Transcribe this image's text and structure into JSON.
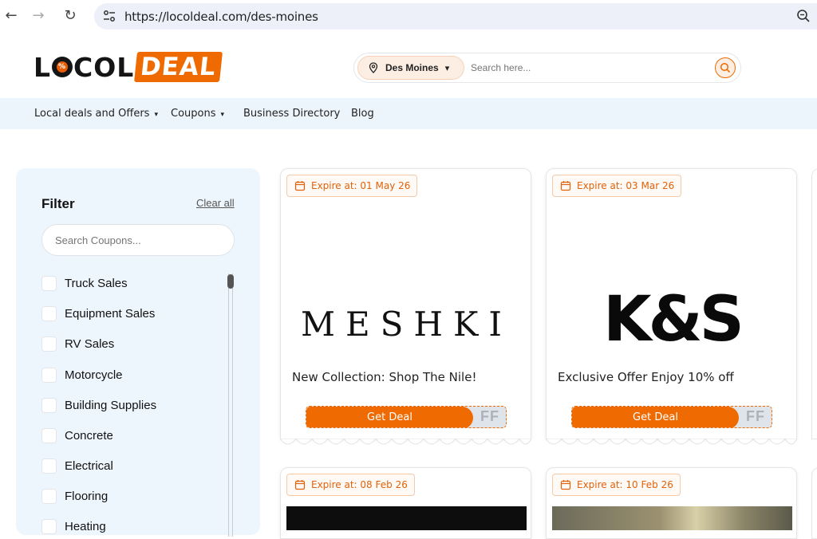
{
  "browser": {
    "url": "https://locoldeal.com/des-moines",
    "back_icon": "←",
    "forward_icon": "→",
    "reload_icon": "↻"
  },
  "header": {
    "logo_loco_l": "L",
    "logo_loco_rest": "COL",
    "logo_deal": "DEAL",
    "city": "Des Moines",
    "search_placeholder": "Search here..."
  },
  "nav": {
    "items": [
      {
        "label": "Local deals and Offers",
        "chevron": "▾"
      },
      {
        "label": "Coupons",
        "chevron": "▾"
      },
      {
        "label": "Business Directory"
      },
      {
        "label": "Blog"
      }
    ]
  },
  "filter": {
    "title": "Filter",
    "clear_all": "Clear all",
    "search_placeholder": "Search Coupons...",
    "categories": [
      "Truck Sales",
      "Equipment Sales",
      "RV Sales",
      "Motorcycle",
      "Building Supplies",
      "Concrete",
      "Electrical",
      "Flooring",
      "Heating"
    ]
  },
  "cards": [
    {
      "expire": "Expire at: 01 May 26",
      "brand": "MESHKI",
      "title": "New Collection: Shop The Nile!",
      "button": "Get Deal",
      "code_hint": "FF"
    },
    {
      "expire": "Expire at: 03 Mar 26",
      "brand": "K&S",
      "title": "Exclusive Offer Enjoy 10% off",
      "button": "Get Deal",
      "code_hint": "FF"
    },
    {
      "expire": "Expire at: 08 Feb 26"
    },
    {
      "expire": "Expire at: 10 Feb 26"
    }
  ],
  "colors": {
    "accent": "#ef6a00",
    "nav_bg": "#edf5fc",
    "filter_bg": "#eef6fd"
  }
}
